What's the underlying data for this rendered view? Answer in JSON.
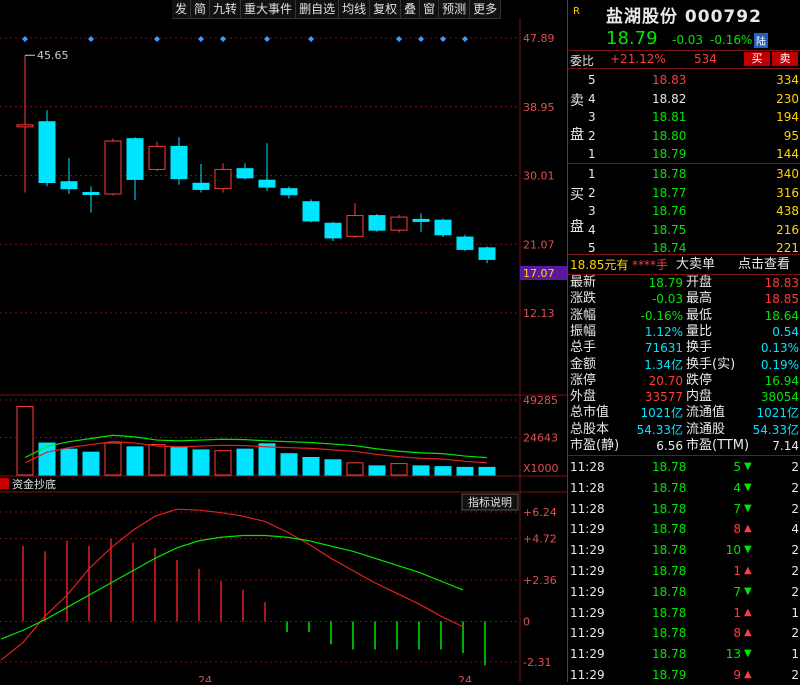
{
  "toolbar": {
    "items": [
      "发",
      "简",
      "九转",
      "重大事件",
      "删自选",
      "均线",
      "复权",
      "叠",
      "窗",
      "预测",
      "更多"
    ]
  },
  "chart": {
    "price_axis": [
      "47.89",
      "38.95",
      "30.01",
      "21.07",
      "17.07",
      "12.13"
    ],
    "vol_axis": [
      "49285",
      "24643",
      "X1000"
    ],
    "ind_axis": [
      "+6.24",
      "+4.72",
      "+2.36",
      "0",
      "-2.31"
    ],
    "high_label": "45.65",
    "indicator_name": "资金抄底",
    "indicator_btn": "指标说明",
    "bottom_tick": "24",
    "bottom_tick2": "24"
  },
  "chart_data": {
    "type": "candlestick",
    "candles": [
      {
        "o": 36.6,
        "c": 36.6,
        "h": 45.65,
        "l": 27.8
      },
      {
        "o": 37.0,
        "c": 29.1,
        "h": 38.5,
        "l": 28.6
      },
      {
        "o": 29.2,
        "c": 28.3,
        "h": 32.3,
        "l": 27.6
      },
      {
        "o": 27.8,
        "c": 27.8,
        "h": 28.6,
        "l": 25.2
      },
      {
        "o": 27.6,
        "c": 34.5,
        "h": 34.8,
        "l": 27.4
      },
      {
        "o": 34.8,
        "c": 29.5,
        "h": 35.0,
        "l": 26.8
      },
      {
        "o": 30.8,
        "c": 33.8,
        "h": 34.4,
        "l": 30.6
      },
      {
        "o": 33.8,
        "c": 29.6,
        "h": 35.0,
        "l": 28.8
      },
      {
        "o": 29.0,
        "c": 28.2,
        "h": 31.5,
        "l": 27.8
      },
      {
        "o": 28.3,
        "c": 30.8,
        "h": 31.6,
        "l": 27.8
      },
      {
        "o": 30.9,
        "c": 29.7,
        "h": 31.6,
        "l": 29.5
      },
      {
        "o": 29.4,
        "c": 28.5,
        "h": 34.2,
        "l": 28.0
      },
      {
        "o": 28.3,
        "c": 27.5,
        "h": 28.6,
        "l": 27.0
      },
      {
        "o": 26.6,
        "c": 24.1,
        "h": 26.9,
        "l": 23.9
      },
      {
        "o": 23.8,
        "c": 21.9,
        "h": 24.0,
        "l": 21.5
      },
      {
        "o": 22.1,
        "c": 24.8,
        "h": 26.4,
        "l": 21.9
      },
      {
        "o": 24.8,
        "c": 22.9,
        "h": 25.0,
        "l": 22.7
      },
      {
        "o": 22.9,
        "c": 24.6,
        "h": 24.9,
        "l": 22.6
      },
      {
        "o": 24.3,
        "c": 24.3,
        "h": 25.1,
        "l": 22.7
      },
      {
        "o": 24.2,
        "c": 22.3,
        "h": 24.4,
        "l": 22.0
      },
      {
        "o": 22.0,
        "c": 20.4,
        "h": 22.3,
        "l": 20.2
      },
      {
        "o": 20.6,
        "c": 19.1,
        "h": 20.8,
        "l": 18.6
      }
    ],
    "volume": [
      45000,
      21000,
      17000,
      15000,
      21000,
      18500,
      20000,
      18500,
      16500,
      16000,
      17000,
      20500,
      14000,
      11500,
      10000,
      8000,
      6000,
      7500,
      6000,
      5500,
      5000,
      5000
    ],
    "ma_price": [
      40.5,
      33.0,
      31.5,
      30.8,
      30.5,
      31.0,
      31.2,
      31.0,
      30.5,
      30.0,
      29.8,
      29.2,
      28.6,
      27.5,
      26.5,
      25.8,
      25.0,
      24.5,
      24.0,
      23.5,
      22.5,
      21.5
    ],
    "ma_vol": [
      8000,
      15000,
      18000,
      20000,
      22000,
      21000,
      19000,
      18500,
      19000,
      19500,
      19300,
      18500,
      18000,
      17500,
      16500,
      15500,
      13500,
      12000,
      11000,
      10500,
      9000,
      8000
    ],
    "indicator_red": [
      -2.2,
      -1.2,
      0.3,
      1.5,
      3.0,
      4.2,
      5.2,
      6.0,
      6.4,
      6.35,
      6.2,
      6.0,
      5.7,
      5.1,
      4.4,
      3.6,
      2.9,
      2.2,
      1.6,
      1.0,
      0.3,
      -0.3
    ],
    "indicator_green": [
      -1.0,
      -0.5,
      0.1,
      0.8,
      1.5,
      2.2,
      2.9,
      3.6,
      4.2,
      4.6,
      4.8,
      4.9,
      4.9,
      4.8,
      4.6,
      4.3,
      4.0,
      3.6,
      3.2,
      2.8,
      2.3,
      1.8
    ],
    "indicator_bars": [
      4.3,
      4.0,
      4.6,
      4.3,
      4.7,
      4.5,
      4.2,
      3.5,
      3.0,
      2.3,
      1.8,
      1.1,
      -0.6,
      -0.6,
      -1.3,
      -1.6,
      -1.6,
      -1.6,
      -1.6,
      -1.6,
      -1.8,
      -2.5
    ]
  },
  "quote": {
    "market": "R",
    "name": "盐湖股份",
    "code": "000792",
    "price": "18.79",
    "change": "-0.03",
    "pct": "-0.16%",
    "tag": "陆",
    "weibi_label": "委比",
    "weibi": "+21.12%",
    "weicha": "534",
    "buy_btn": "买",
    "sell_btn": "卖"
  },
  "book": {
    "sell_label": [
      "卖",
      "盘"
    ],
    "buy_label": [
      "买",
      "盘"
    ],
    "asks": [
      {
        "n": "5",
        "p": "18.83",
        "v": "334"
      },
      {
        "n": "4",
        "p": "18.82",
        "v": "230"
      },
      {
        "n": "3",
        "p": "18.81",
        "v": "194"
      },
      {
        "n": "2",
        "p": "18.80",
        "v": "95"
      },
      {
        "n": "1",
        "p": "18.79",
        "v": "144"
      }
    ],
    "bids": [
      {
        "n": "1",
        "p": "18.78",
        "v": "340"
      },
      {
        "n": "2",
        "p": "18.77",
        "v": "316"
      },
      {
        "n": "3",
        "p": "18.76",
        "v": "438"
      },
      {
        "n": "4",
        "p": "18.75",
        "v": "216"
      },
      {
        "n": "5",
        "p": "18.74",
        "v": "221"
      }
    ]
  },
  "bigorder": {
    "price": "18.85元有",
    "qty": "****手",
    "label": "大卖单",
    "link": "点击查看"
  },
  "stats": [
    {
      "l1": "最新",
      "v1": "18.79",
      "c1": "grn",
      "l2": "开盘",
      "v2": "18.83",
      "c2": "red"
    },
    {
      "l1": "涨跌",
      "v1": "-0.03",
      "c1": "grn",
      "l2": "最高",
      "v2": "18.85",
      "c2": "red"
    },
    {
      "l1": "涨幅",
      "v1": "-0.16%",
      "c1": "grn",
      "l2": "最低",
      "v2": "18.64",
      "c2": "grn"
    },
    {
      "l1": "振幅",
      "v1": "1.12%",
      "c1": "cy",
      "l2": "量比",
      "v2": "0.54",
      "c2": "cy"
    },
    {
      "l1": "总手",
      "v1": "71631",
      "c1": "cy",
      "l2": "换手",
      "v2": "0.13%",
      "c2": "cy"
    },
    {
      "l1": "金额",
      "v1": "1.34亿",
      "c1": "cy",
      "l2": "换手(实)",
      "v2": "0.19%",
      "c2": "cy"
    },
    {
      "l1": "涨停",
      "v1": "20.70",
      "c1": "red",
      "l2": "跌停",
      "v2": "16.94",
      "c2": "grn"
    },
    {
      "l1": "外盘",
      "v1": "33577",
      "c1": "red",
      "l2": "内盘",
      "v2": "38054",
      "c2": "grn"
    },
    {
      "l1": "总市值",
      "v1": "1021亿",
      "c1": "cy",
      "l2": "流通值",
      "v2": "1021亿",
      "c2": "cy"
    },
    {
      "l1": "总股本",
      "v1": "54.33亿",
      "c1": "cy",
      "l2": "流通股",
      "v2": "54.33亿",
      "c2": "cy"
    },
    {
      "l1": "市盈(静)",
      "v1": "6.56",
      "c1": "wht",
      "l2": "市盈(TTM)",
      "v2": "7.14",
      "c2": "wht"
    }
  ],
  "ticks": [
    {
      "t": "11:28",
      "p": "18.78",
      "v": "5",
      "d": "down",
      "x": "2"
    },
    {
      "t": "11:28",
      "p": "18.78",
      "v": "4",
      "d": "down",
      "x": "2"
    },
    {
      "t": "11:28",
      "p": "18.78",
      "v": "7",
      "d": "down",
      "x": "2"
    },
    {
      "t": "11:29",
      "p": "18.78",
      "v": "8",
      "d": "up",
      "x": "4"
    },
    {
      "t": "11:29",
      "p": "18.78",
      "v": "10",
      "d": "down",
      "x": "2"
    },
    {
      "t": "11:29",
      "p": "18.78",
      "v": "1",
      "d": "up",
      "x": "2"
    },
    {
      "t": "11:29",
      "p": "18.78",
      "v": "7",
      "d": "down",
      "x": "2"
    },
    {
      "t": "11:29",
      "p": "18.78",
      "v": "1",
      "d": "up",
      "x": "1"
    },
    {
      "t": "11:29",
      "p": "18.78",
      "v": "8",
      "d": "up",
      "x": "2"
    },
    {
      "t": "11:29",
      "p": "18.78",
      "v": "13",
      "d": "down",
      "x": "1"
    },
    {
      "t": "11:29",
      "p": "18.79",
      "v": "9",
      "d": "up",
      "x": "2"
    }
  ],
  "colors": {
    "up": "#ff3b3b",
    "down": "#00e5ff",
    "grid": "#7a1414",
    "green": "#00e600",
    "yellow": "#ffd400",
    "purple": "#5a1aa0"
  }
}
